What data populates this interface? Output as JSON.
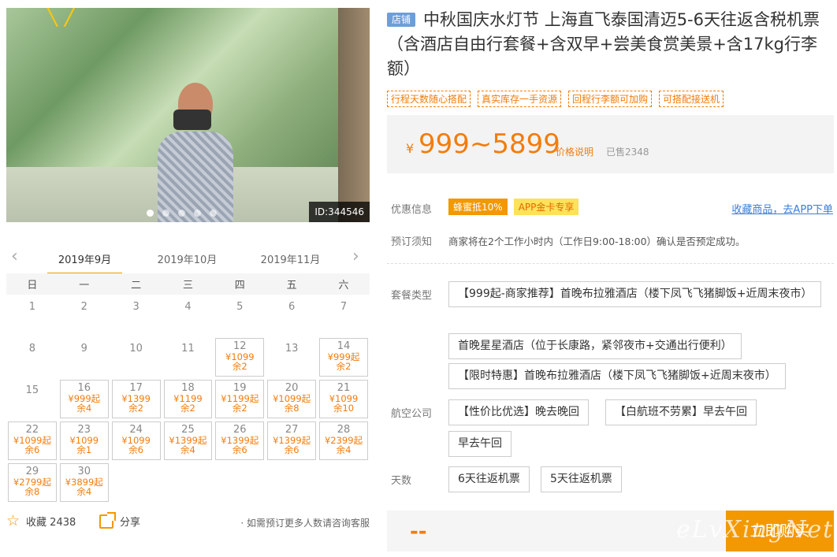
{
  "photo": {
    "id_label": "ID:344546",
    "dots": [
      true,
      false,
      false,
      false,
      false
    ]
  },
  "calendar": {
    "months": [
      "2019年9月",
      "2019年10月",
      "2019年11月"
    ],
    "weekdays": [
      "日",
      "一",
      "二",
      "三",
      "四",
      "五",
      "六"
    ],
    "weeks": [
      [
        {
          "d": "1"
        },
        {
          "d": "2"
        },
        {
          "d": "3"
        },
        {
          "d": "4"
        },
        {
          "d": "5"
        },
        {
          "d": "6"
        },
        {
          "d": "7"
        }
      ],
      [
        {
          "d": "8"
        },
        {
          "d": "9"
        },
        {
          "d": "10"
        },
        {
          "d": "11"
        },
        {
          "d": "12",
          "p": "¥1099",
          "r": "余2"
        },
        {
          "d": "13"
        },
        {
          "d": "14",
          "p": "¥999起",
          "r": "余2"
        }
      ],
      [
        {
          "d": "15"
        },
        {
          "d": "16",
          "p": "¥999起",
          "r": "余4"
        },
        {
          "d": "17",
          "p": "¥1399",
          "r": "余2"
        },
        {
          "d": "18",
          "p": "¥1199",
          "r": "余2"
        },
        {
          "d": "19",
          "p": "¥1199起",
          "r": "余2"
        },
        {
          "d": "20",
          "p": "¥1099起",
          "r": "余8"
        },
        {
          "d": "21",
          "p": "¥1099",
          "r": "余10"
        }
      ],
      [
        {
          "d": "22",
          "p": "¥1099起",
          "r": "余6"
        },
        {
          "d": "23",
          "p": "¥1099",
          "r": "余1"
        },
        {
          "d": "24",
          "p": "¥1099",
          "r": "余6"
        },
        {
          "d": "25",
          "p": "¥1399起",
          "r": "余4"
        },
        {
          "d": "26",
          "p": "¥1399起",
          "r": "余6"
        },
        {
          "d": "27",
          "p": "¥1399起",
          "r": "余6"
        },
        {
          "d": "28",
          "p": "¥2399起",
          "r": "余4"
        }
      ],
      [
        {
          "d": "29",
          "p": "¥2799起",
          "r": "余8"
        },
        {
          "d": "30",
          "p": "¥3899起",
          "r": "余4"
        }
      ]
    ]
  },
  "bottom_left": {
    "fav_label": "收藏 2438",
    "share_label": "分享",
    "note": "· 如需预订更多人数请咨询客服"
  },
  "product": {
    "badge": "店铺",
    "title": "中秋国庆水灯节 上海直飞泰国清迈5-6天往返含税机票（含酒店自由行套餐+含双早+尝美食赏美景+含17kg行李额）",
    "tags": [
      "行程天数随心搭配",
      "真实库存一手资源",
      "回程行李额可加购",
      "可搭配接送机"
    ]
  },
  "price": {
    "currency": "¥",
    "value": "999~5899",
    "desc": "价格说明",
    "sold": "已售2348"
  },
  "promo": {
    "label": "优惠信息",
    "tag1": "蜂蜜抵10%",
    "tag2": "APP金卡专享",
    "app_link": "收藏商品，去APP下单"
  },
  "booking": {
    "label": "预订须知",
    "text": "商家将在2个工作小时内（工作日9:00-18:00）确认是否预定成功。"
  },
  "package": {
    "label": "套餐类型",
    "options": [
      "【999起-商家推荐】首晚布拉雅酒店（楼下凤飞飞猪脚饭+近周末夜市）",
      "首晚星星酒店（位于长康路，紧邻夜市+交通出行便利）",
      "【限时特惠】首晚布拉雅酒店（楼下凤飞飞猪脚饭+近周末夜市）"
    ]
  },
  "airline": {
    "label": "航空公司",
    "options": [
      "【性价比优选】晚去晚回",
      "【白航班不劳累】早去午回",
      "早去午回"
    ]
  },
  "days": {
    "label": "天数",
    "options": [
      "6天往返机票",
      "5天往返机票"
    ]
  },
  "action": {
    "price_placeholder": "--",
    "buy_label": "立即购买"
  },
  "watermark": "eLvXingNet",
  "colors": {
    "accent": "#f39800",
    "price": "#f37c0b",
    "link": "#3a7ed6"
  }
}
